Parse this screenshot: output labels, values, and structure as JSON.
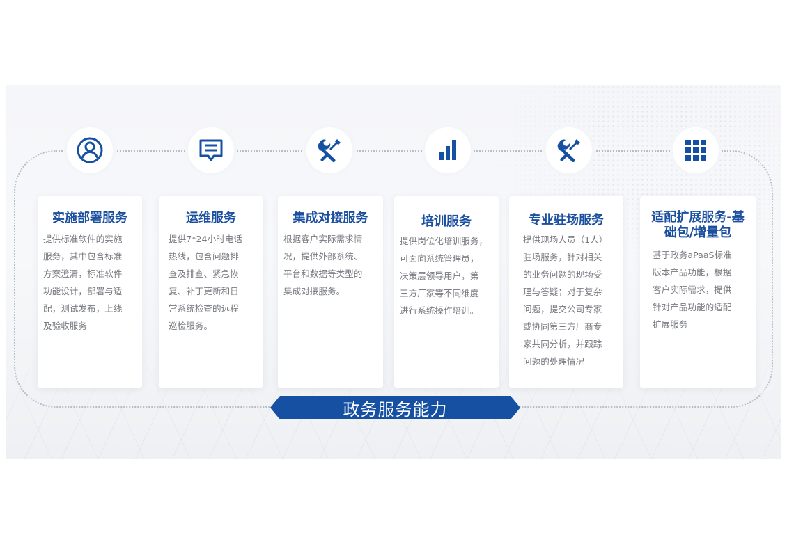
{
  "colors": {
    "accent": "#1650a3",
    "title": "#1b4fa0",
    "body_text": "#777a80"
  },
  "services": [
    {
      "icon": "user-icon",
      "title": "实施部署服务",
      "body": [
        "提供标准软件的实施",
        "服务，其中包含标准",
        "方案澄清，标准软件",
        "功能设计，部署与适",
        "配，测试发布，上线",
        "及验收服务"
      ]
    },
    {
      "icon": "chat-icon",
      "title": "运维服务",
      "body": [
        "提供7*24小时电话",
        "热线，包含问题排",
        "查及排查、紧急恢",
        "复、补丁更新和日",
        "常系统检查的远程",
        "巡检服务。"
      ]
    },
    {
      "icon": "tools-icon",
      "title": "集成对接服务",
      "body": [
        "根据客户实际需求情",
        "况，提供外部系统、",
        "平台和数据等类型的",
        "集成对接服务。"
      ]
    },
    {
      "icon": "bar-chart-icon",
      "title": "培训服务",
      "body": [
        "提供岗位化培训服务，",
        "可面向系统管理员，",
        "决策层领导用户，第",
        "三方厂家等不同维度",
        "进行系统操作培训。"
      ]
    },
    {
      "icon": "tools-icon",
      "title": "专业驻场服务",
      "body": [
        "提供现场人员（1人）",
        "驻场服务，针对相关",
        "的业务问题的现场受",
        "理与答疑；对于复杂",
        "问题，提交公司专家",
        "或协同第三方厂商专",
        "家共同分析，并跟踪",
        "问题的处理情况"
      ]
    },
    {
      "icon": "grid-icon",
      "title": "适配扩展服务-基础包/增量包",
      "title_lines": [
        "适配扩展服务-基",
        "础包/增量包"
      ],
      "body": [
        "基于政务aPaaS标准",
        "版本产品功能，根据",
        "客户实际需求，提供",
        "针对产品功能的适配",
        "扩展服务"
      ]
    }
  ],
  "banner": {
    "label": "政务服务能力"
  }
}
